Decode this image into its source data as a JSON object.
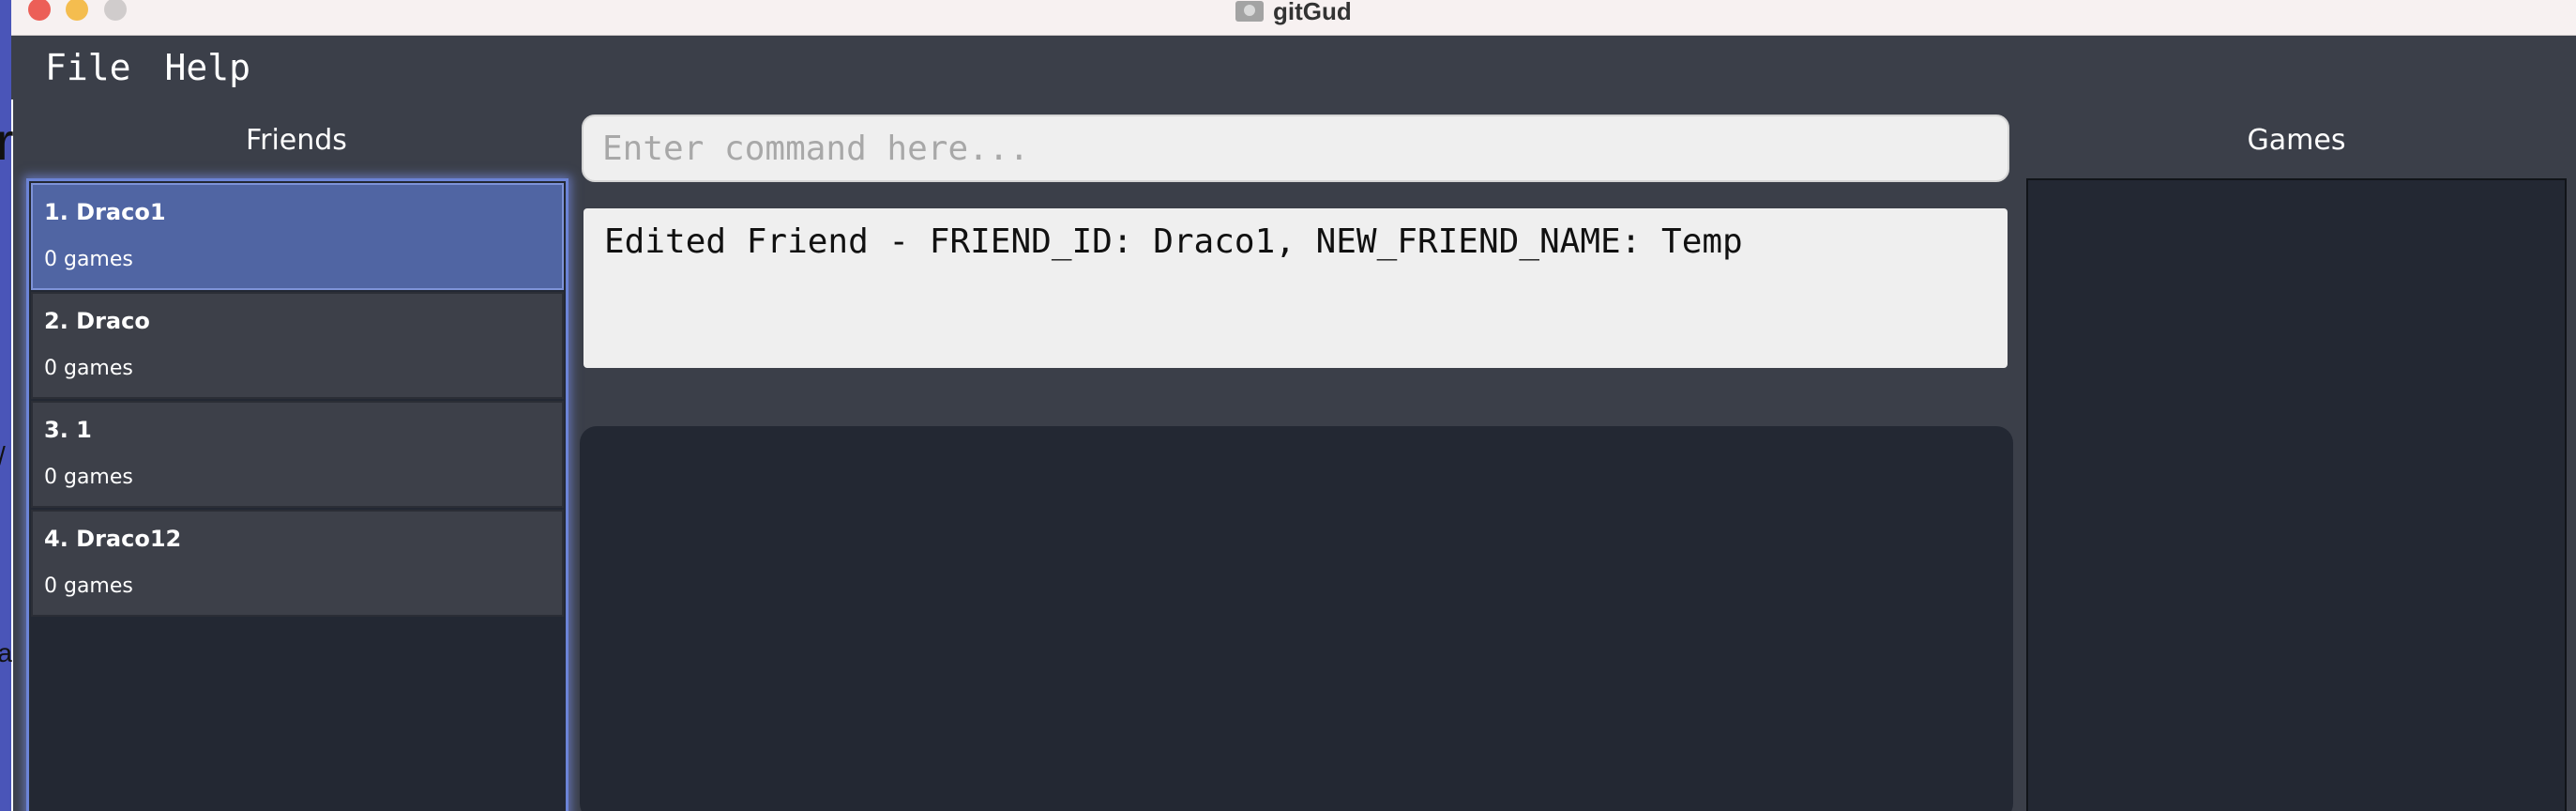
{
  "window": {
    "title": "gitGud"
  },
  "behind": {
    "fragments": [
      "r",
      "/",
      "ra"
    ]
  },
  "menu": {
    "items": [
      {
        "label": "File"
      },
      {
        "label": "Help"
      }
    ]
  },
  "friends_panel": {
    "title": "Friends",
    "items": [
      {
        "name": "1. Draco1",
        "count": "0 games",
        "selected": true
      },
      {
        "name": "2. Draco",
        "count": "0 games",
        "selected": false
      },
      {
        "name": "3. 1",
        "count": "0 games",
        "selected": false
      },
      {
        "name": "4. Draco12",
        "count": "0 games",
        "selected": false
      }
    ]
  },
  "command": {
    "placeholder": "Enter command here...",
    "value": ""
  },
  "result": {
    "text": "Edited Friend - FRIEND_ID: Draco1, NEW_FRIEND_NAME: Temp"
  },
  "games_panel": {
    "title": "Games"
  },
  "colors": {
    "background": "#3b3f49",
    "panel": "#232833",
    "selected": "#5065a3",
    "selection_glow": "#6c84d6"
  }
}
